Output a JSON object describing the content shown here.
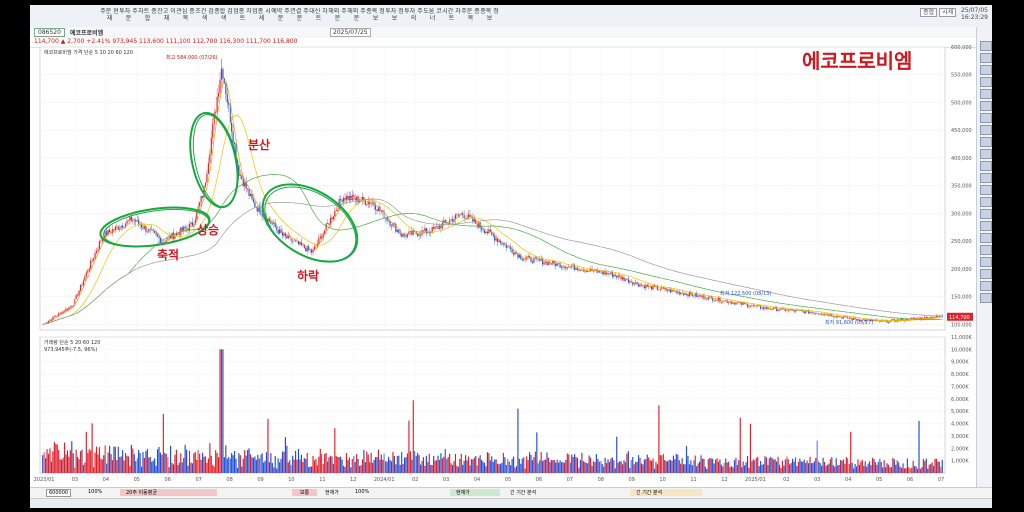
{
  "app": {
    "top_right": [
      "25/07/05",
      "16:23:29"
    ],
    "top_btn": [
      "종합",
      "시세"
    ]
  },
  "toolbar": {
    "buttons": [
      "주문",
      "현재",
      "투자",
      "주문",
      "차트",
      "종합",
      "잔고",
      "이체",
      "관심",
      "종목",
      "조건",
      "검색",
      "종합",
      "검색",
      "업종",
      "차트",
      "업종",
      "시세",
      "예약",
      "주문",
      "연결",
      "주문",
      "대신",
      "차트",
      "해외",
      "주문",
      "해외",
      "주문",
      "종목",
      "정보",
      "투자",
      "정보",
      "투자",
      "주의",
      "도움",
      "코너",
      "시간",
      "차트",
      "주문",
      "종목",
      "종목",
      "정보"
    ]
  },
  "row2": {
    "code": "086520",
    "name": "에코프로비엠",
    "period": "2025/07/25"
  },
  "row3": {
    "ohlc": "114,700  ▲  2,700  +2.41%  973,945  113,600  111,100  112,700  116,300  111,700  116,800"
  },
  "price_legend": [
    "에코프로비엠",
    "가격 단순",
    "5",
    "10",
    "20",
    "60",
    "120"
  ],
  "vol_legend": [
    "거래량",
    "단순",
    "5",
    "20",
    "60",
    "120"
  ],
  "vol_info": "973,945주(-7.5, 96%)",
  "max_label": "최고 584,000 (07/26)",
  "min_label": "최저 91,600 (05/27)",
  "mid_label1": "최저 122,500 (08/13)",
  "overlay_title": "에코프로비엠",
  "annotations": [
    "축적",
    "상승",
    "분산",
    "하락"
  ],
  "price_axis": [
    "600,000",
    "550,000",
    "500,000",
    "450,000",
    "400,000",
    "350,000",
    "300,000",
    "250,000",
    "200,000",
    "150,000",
    "100,000"
  ],
  "volume_axis": [
    "11,000K",
    "10,000K",
    "9,000K",
    "8,000K",
    "7,000K",
    "6,000K",
    "5,000K",
    "4,000K",
    "3,000K",
    "2,000K",
    "1,000K"
  ],
  "last_price": "114,700",
  "x_labels": [
    "2023/01",
    "03",
    "04",
    "05",
    "06",
    "07",
    "08",
    "09",
    "10",
    "11",
    "12",
    "2024/01",
    "02",
    "03",
    "04",
    "05",
    "06",
    "07",
    "08",
    "09",
    "10",
    "11",
    "12",
    "2025/01",
    "02",
    "03",
    "04",
    "05",
    "06",
    "07"
  ],
  "bottom": {
    "left": "600000",
    "b1": "100%",
    "b2": "20주 이동평균",
    "c1": "보통",
    "c2": "현재가",
    "c3": "100%",
    "d1": "현재가",
    "d2": "긴 기간 분석",
    "e1": "긴 기간 분석"
  },
  "chart_data": {
    "type": "candlestick",
    "price_ylim": [
      90000,
      600000
    ],
    "volume_ylim": [
      0,
      11000000
    ],
    "months": [
      "2023/01",
      "2023/02",
      "2023/03",
      "2023/04",
      "2023/05",
      "2023/06",
      "2023/07",
      "2023/08",
      "2023/09",
      "2023/10",
      "2023/11",
      "2023/12",
      "2024/01",
      "2024/02",
      "2024/03",
      "2024/04",
      "2024/05",
      "2024/06",
      "2024/07",
      "2024/08",
      "2024/09",
      "2024/10",
      "2024/11",
      "2024/12",
      "2025/01",
      "2025/02",
      "2025/03",
      "2025/04",
      "2025/05",
      "2025/06",
      "2025/07"
    ],
    "monthly_close": [
      100000,
      135000,
      260000,
      290000,
      250000,
      280000,
      440000,
      320000,
      260000,
      230000,
      330000,
      320000,
      260000,
      270000,
      300000,
      260000,
      220000,
      210000,
      200000,
      190000,
      170000,
      160000,
      150000,
      140000,
      130000,
      125000,
      120000,
      110000,
      105000,
      110000,
      114700
    ],
    "max_price": 584000,
    "min_price": 91600
  }
}
